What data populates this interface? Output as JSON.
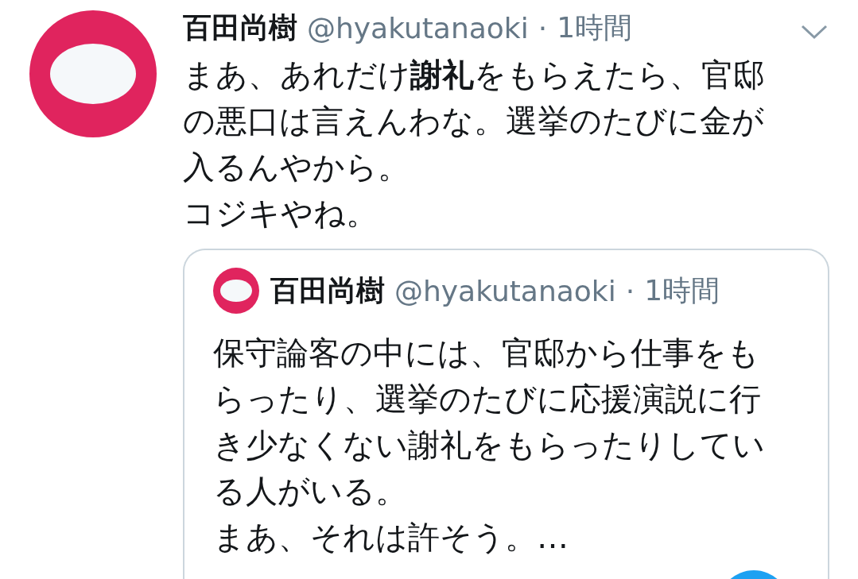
{
  "tweet": {
    "name": "百田尚樹",
    "handle": "@hyakutanaoki",
    "separator": "·",
    "time": "1時間",
    "paragraphs": [
      "まあ、あれだけ**謝礼**をもらえたら、官邸の悪口は言えんわな。選挙のたびに金が入るんやから。",
      "コジキやね。"
    ],
    "quoted": {
      "name": "百田尚樹",
      "handle": "@hyakutanaoki",
      "separator": "·",
      "time": "1時間",
      "paragraphs": [
        "保守論客の中には、官邸から仕事をもらったり、選挙のたびに応援演説に行き少なくない謝礼をもらったりしている人がいる。",
        "まあ、それは許そう。…"
      ]
    }
  }
}
